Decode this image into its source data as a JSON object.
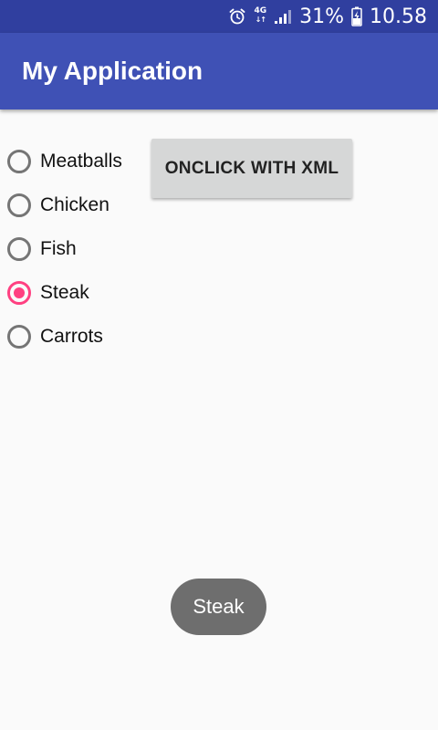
{
  "status_bar": {
    "network_label": "4G",
    "battery_percent": "31%",
    "time": "10.58",
    "icons": [
      "alarm-icon",
      "network-4g-icon",
      "signal-icon",
      "battery-charging-icon"
    ]
  },
  "app_bar": {
    "title": "My Application"
  },
  "radio_group": {
    "options": [
      {
        "label": "Meatballs",
        "checked": false
      },
      {
        "label": "Chicken",
        "checked": false
      },
      {
        "label": "Fish",
        "checked": false
      },
      {
        "label": "Steak",
        "checked": true
      },
      {
        "label": "Carrots",
        "checked": false
      }
    ]
  },
  "button": {
    "label": "ONCLICK WITH XML"
  },
  "toast": {
    "text": "Steak"
  },
  "colors": {
    "status_bar": "#303f9f",
    "primary": "#3f51b5",
    "accent": "#ff4081",
    "background": "#fafafa"
  }
}
